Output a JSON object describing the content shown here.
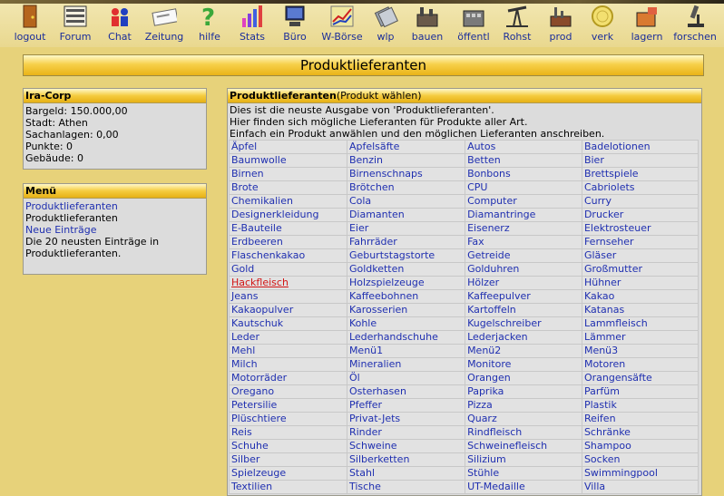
{
  "toolbar": {
    "items": [
      {
        "label": "logout",
        "icon": "door-icon"
      },
      {
        "label": "Forum",
        "icon": "forum-board-icon"
      },
      {
        "label": "Chat",
        "icon": "chat-people-icon"
      },
      {
        "label": "Zeitung",
        "icon": "newspaper-icon"
      },
      {
        "label": "hilfe",
        "icon": "question-mark-icon"
      },
      {
        "label": "Stats",
        "icon": "bar-chart-icon"
      },
      {
        "label": "Büro",
        "icon": "computer-icon"
      },
      {
        "label": "W-Börse",
        "icon": "stock-chart-icon"
      },
      {
        "label": "wlp",
        "icon": "paper-stack-icon"
      },
      {
        "label": "bauen",
        "icon": "factory-build-icon"
      },
      {
        "label": "öffentl",
        "icon": "public-building-icon"
      },
      {
        "label": "Rohst",
        "icon": "oil-pump-icon"
      },
      {
        "label": "prod",
        "icon": "production-plant-icon"
      },
      {
        "label": "verk",
        "icon": "coin-icon"
      },
      {
        "label": "lagern",
        "icon": "warehouse-icon"
      },
      {
        "label": "forschen",
        "icon": "microscope-icon"
      }
    ]
  },
  "title": "Produktlieferanten",
  "company_panel": {
    "name": "Ira-Corp",
    "bargeld": "Bargeld: 150.000,00",
    "stadt": "Stadt: Athen",
    "sachanlagen": "Sachanlagen: 0,00",
    "punkte": "Punkte: 0",
    "gebaeude": "Gebäude: 0"
  },
  "menu_panel": {
    "heading": "Menü",
    "link1": "Produktlieferanten",
    "desc1": "Produktlieferanten",
    "link2": "Neue Einträge",
    "desc2": "Die 20 neusten Einträge in Produktlieferanten."
  },
  "main": {
    "heading": "Produktlieferanten",
    "subheading": "(Produkt wählen)",
    "intro1": "Dies ist die neuste Ausgabe von 'Produktlieferanten'.",
    "intro2": "Hier finden sich mögliche Lieferanten für Produkte aller Art.",
    "intro3": "Einfach ein Produkt anwählen und den möglichen Lieferanten anschreiben.",
    "active_product": "Hackfleisch",
    "products": [
      [
        "Äpfel",
        "Apfelsäfte",
        "Autos",
        "Badelotionen"
      ],
      [
        "Baumwolle",
        "Benzin",
        "Betten",
        "Bier"
      ],
      [
        "Birnen",
        "Birnenschnaps",
        "Bonbons",
        "Brettspiele"
      ],
      [
        "Brote",
        "Brötchen",
        "CPU",
        "Cabriolets"
      ],
      [
        "Chemikalien",
        "Cola",
        "Computer",
        "Curry"
      ],
      [
        "Designerkleidung",
        "Diamanten",
        "Diamantringe",
        "Drucker"
      ],
      [
        "E-Bauteile",
        "Eier",
        "Eisenerz",
        "Elektrosteuer"
      ],
      [
        "Erdbeeren",
        "Fahrräder",
        "Fax",
        "Fernseher"
      ],
      [
        "Flaschenkakao",
        "Geburtstagstorte",
        "Getreide",
        "Gläser"
      ],
      [
        "Gold",
        "Goldketten",
        "Golduhren",
        "Großmutter"
      ],
      [
        "Hackfleisch",
        "Holzspielzeuge",
        "Hölzer",
        "Hühner"
      ],
      [
        "Jeans",
        "Kaffeebohnen",
        "Kaffeepulver",
        "Kakao"
      ],
      [
        "Kakaopulver",
        "Karosserien",
        "Kartoffeln",
        "Katanas"
      ],
      [
        "Kautschuk",
        "Kohle",
        "Kugelschreiber",
        "Lammfleisch"
      ],
      [
        "Leder",
        "Lederhandschuhe",
        "Lederjacken",
        "Lämmer"
      ],
      [
        "Mehl",
        "Menü1",
        "Menü2",
        "Menü3"
      ],
      [
        "Milch",
        "Mineralien",
        "Monitore",
        "Motoren"
      ],
      [
        "Motorräder",
        "Öl",
        "Orangen",
        "Orangensäfte"
      ],
      [
        "Oregano",
        "Osterhasen",
        "Paprika",
        "Parfüm"
      ],
      [
        "Petersilie",
        "Pfeffer",
        "Pizza",
        "Plastik"
      ],
      [
        "Plüschtiere",
        "Privat-Jets",
        "Quarz",
        "Reifen"
      ],
      [
        "Reis",
        "Rinder",
        "Rindfleisch",
        "Schränke"
      ],
      [
        "Schuhe",
        "Schweine",
        "Schweinefleisch",
        "Shampoo"
      ],
      [
        "Silber",
        "Silberketten",
        "Silizium",
        "Socken"
      ],
      [
        "Spielzeuge",
        "Stahl",
        "Stühle",
        "Swimmingpool"
      ],
      [
        "Textilien",
        "Tische",
        "UT-Medaille",
        "Villa"
      ]
    ]
  }
}
